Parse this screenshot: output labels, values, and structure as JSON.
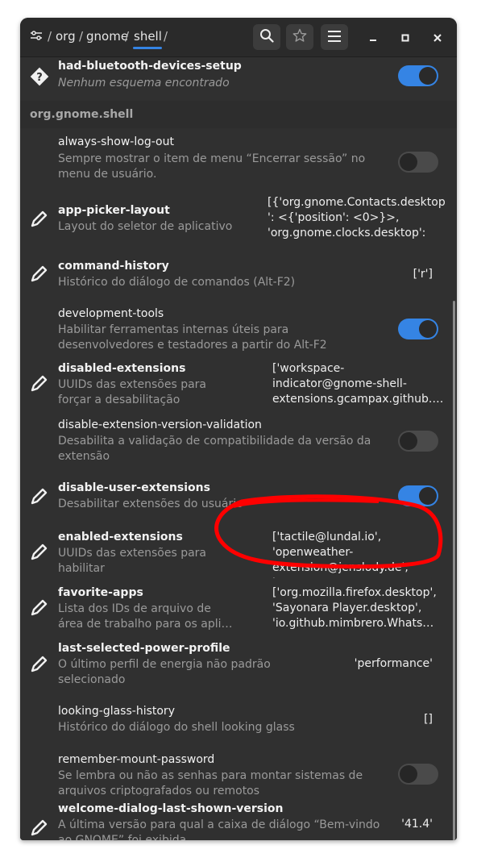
{
  "breadcrumb": {
    "root_sep": "/",
    "parts": [
      "org",
      "gnome",
      "shell"
    ],
    "trailing_sep": "/"
  },
  "rows": {
    "r0": {
      "name": "had-bluetooth-devices-setup",
      "desc": "Nenhum esquema encontrado"
    },
    "section": "org.gnome.shell",
    "r1": {
      "name": "always-show-log-out",
      "desc1": "Sempre mostrar o item de menu “Encerrar sessão” no",
      "desc2": "menu de usuário."
    },
    "r2": {
      "name": "app-picker-layout",
      "desc1": "Layout do seletor de aplicativo",
      "v1": "[{'org.gnome.Contacts.desktop",
      "v2": "': <{'position': <0>}>,",
      "v3": "'org.gnome.clocks.desktop': …"
    },
    "r3": {
      "name": "command-history",
      "desc1": "Histórico do diálogo de comandos (Alt-F2)",
      "v1": "['r']"
    },
    "r4": {
      "name": "development-tools",
      "desc1": "Habilitar ferramentas internas úteis para",
      "desc2": "desenvolvedores e testadores a partir do Alt-F2"
    },
    "r5": {
      "name": "disabled-extensions",
      "desc1": "UUIDs das extensões para",
      "desc2": "forçar a desabilitação",
      "v1": "['workspace-",
      "v2": "indicator@gnome-shell-",
      "v3": "extensions.gcampax.github.…"
    },
    "r6": {
      "name": "disable-extension-version-validation",
      "desc1": "Desabilita a validação de compatibilidade da versão da",
      "desc2": "extensão"
    },
    "r7": {
      "name": "disable-user-extensions",
      "desc1": "Desabilitar extensões do usuário"
    },
    "r8": {
      "name": "enabled-extensions",
      "desc1": "UUIDs das extensões para",
      "desc2": "habilitar",
      "v1": "['tactile@lundal.io',",
      "v2": "'openweather-",
      "v3": "extension@jenslody.de', 'so…"
    },
    "r9": {
      "name": "favorite-apps",
      "desc1": "Lista dos IDs de arquivo de",
      "desc2": "área de trabalho para os apli…",
      "v1": "['org.mozilla.firefox.desktop',",
      "v2": "'Sayonara Player.desktop',",
      "v3": "'io.github.mimbrero.Whats…"
    },
    "r10": {
      "name": "last-selected-power-profile",
      "desc1": "O último perfil de energia não padrão",
      "desc2": "selecionado",
      "v1": "'performance'"
    },
    "r11": {
      "name": "looking-glass-history",
      "desc1": "Histórico do diálogo do shell looking glass",
      "v1": "[]"
    },
    "r12": {
      "name": "remember-mount-password",
      "desc1": "Se lembra ou não as senhas para montar sistemas de",
      "desc2": "arquivos criptografados ou remotos"
    },
    "r13": {
      "name": "welcome-dialog-last-shown-version",
      "desc1": "A última versão para qual a caixa de diálogo “Bem-vindo",
      "desc2": "ao GNOME” foi exibida",
      "v1": "'41.4'"
    }
  },
  "toggles": {
    "r0": true,
    "r1": false,
    "r4": true,
    "r6": false,
    "r7": true,
    "r12": false
  },
  "colors": {
    "accent": "#3584e4",
    "annotation": "#ff0000"
  }
}
